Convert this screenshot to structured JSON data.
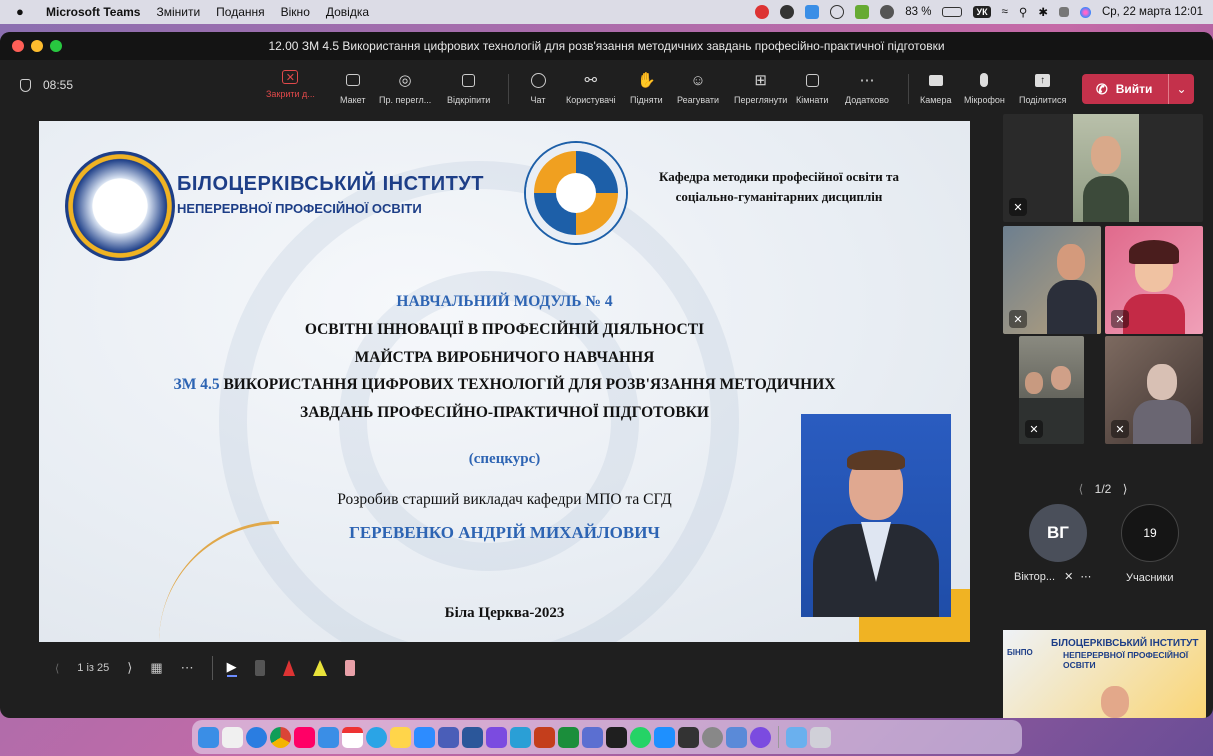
{
  "menubar": {
    "app_name": "Microsoft Teams",
    "items": [
      "Змінити",
      "Подання",
      "Вікно",
      "Довідка"
    ],
    "battery": "83 %",
    "keyboard_layout": "УК",
    "datetime": "Ср, 22 марта  12:01"
  },
  "window": {
    "title": "12.00 ЗМ 4.5 Використання цифрових технологій для розв'язання методичних завдань професійно-практичної підготовки"
  },
  "toolbar": {
    "timer": "08:55",
    "buttons": {
      "close_share": "Закрити д...",
      "layout": "Макет",
      "presenter_view": "Пр. перегл...",
      "popout": "Відкріпити",
      "chat": "Чат",
      "people": "Користувачі",
      "raise": "Підняти",
      "react": "Реагувати",
      "view": "Переглянути",
      "rooms": "Кімнати",
      "more": "Додатково",
      "camera": "Камера",
      "mic": "Мікрофон",
      "share": "Поділитися"
    },
    "leave": "Вийти"
  },
  "slide": {
    "inst_line1": "БІЛОЦЕРКІВСЬКИЙ  ІНСТИТУТ",
    "inst_line2": "НЕПЕРЕРВНОЇ ПРОФЕСІЙНОЇ ОСВІТИ",
    "dept_line1": "Кафедра методики професійної освіти та",
    "dept_line2": "соціально-гуманітарних дисциплін",
    "module": "НАВЧАЛЬНИЙ МОДУЛЬ № 4",
    "title1": "ОСВІТНІ ІННОВАЦІЇ В ПРОФЕСІЙНІЙ ДІЯЛЬНОСТІ",
    "title2": "МАЙСТРА ВИРОБНИЧОГО НАВЧАННЯ",
    "zm_prefix": "ЗМ 4.5",
    "zm_title": " ВИКОРИСТАННЯ ЦИФРОВИХ ТЕХНОЛОГІЙ ДЛЯ РОЗВ'ЯЗАННЯ МЕТОДИЧНИХ",
    "zm_title2": "ЗАВДАНЬ ПРОФЕСІЙНО-ПРАКТИЧНОЇ ПІДГОТОВКИ",
    "special": "(спецкурс)",
    "author_line": "Розробив старший викладач кафедри МПО та СГД",
    "author_name": "ГЕРЕВЕНКО АНДРІЙ МИХАЙЛОВИЧ",
    "city": "Біла Церква-2023"
  },
  "slide_controls": {
    "counter": "1 із 25"
  },
  "participants": {
    "pager": "1/2",
    "avatar_initials": "ВГ",
    "avatar_name": "Віктор...",
    "count": "19",
    "count_label": "Учасники"
  },
  "thumbnail": {
    "badge": "БІНПО",
    "line1": "БІЛОЦЕРКІВСЬКИЙ ІНСТИТУТ",
    "line2": "НЕПЕРЕРВНОЇ ПРОФЕСІЙНОЇ ОСВІТИ"
  },
  "colors": {
    "accent_blue": "#2d64b3",
    "leave_red": "#c4314b",
    "teams_bg": "#1f1f1f"
  }
}
